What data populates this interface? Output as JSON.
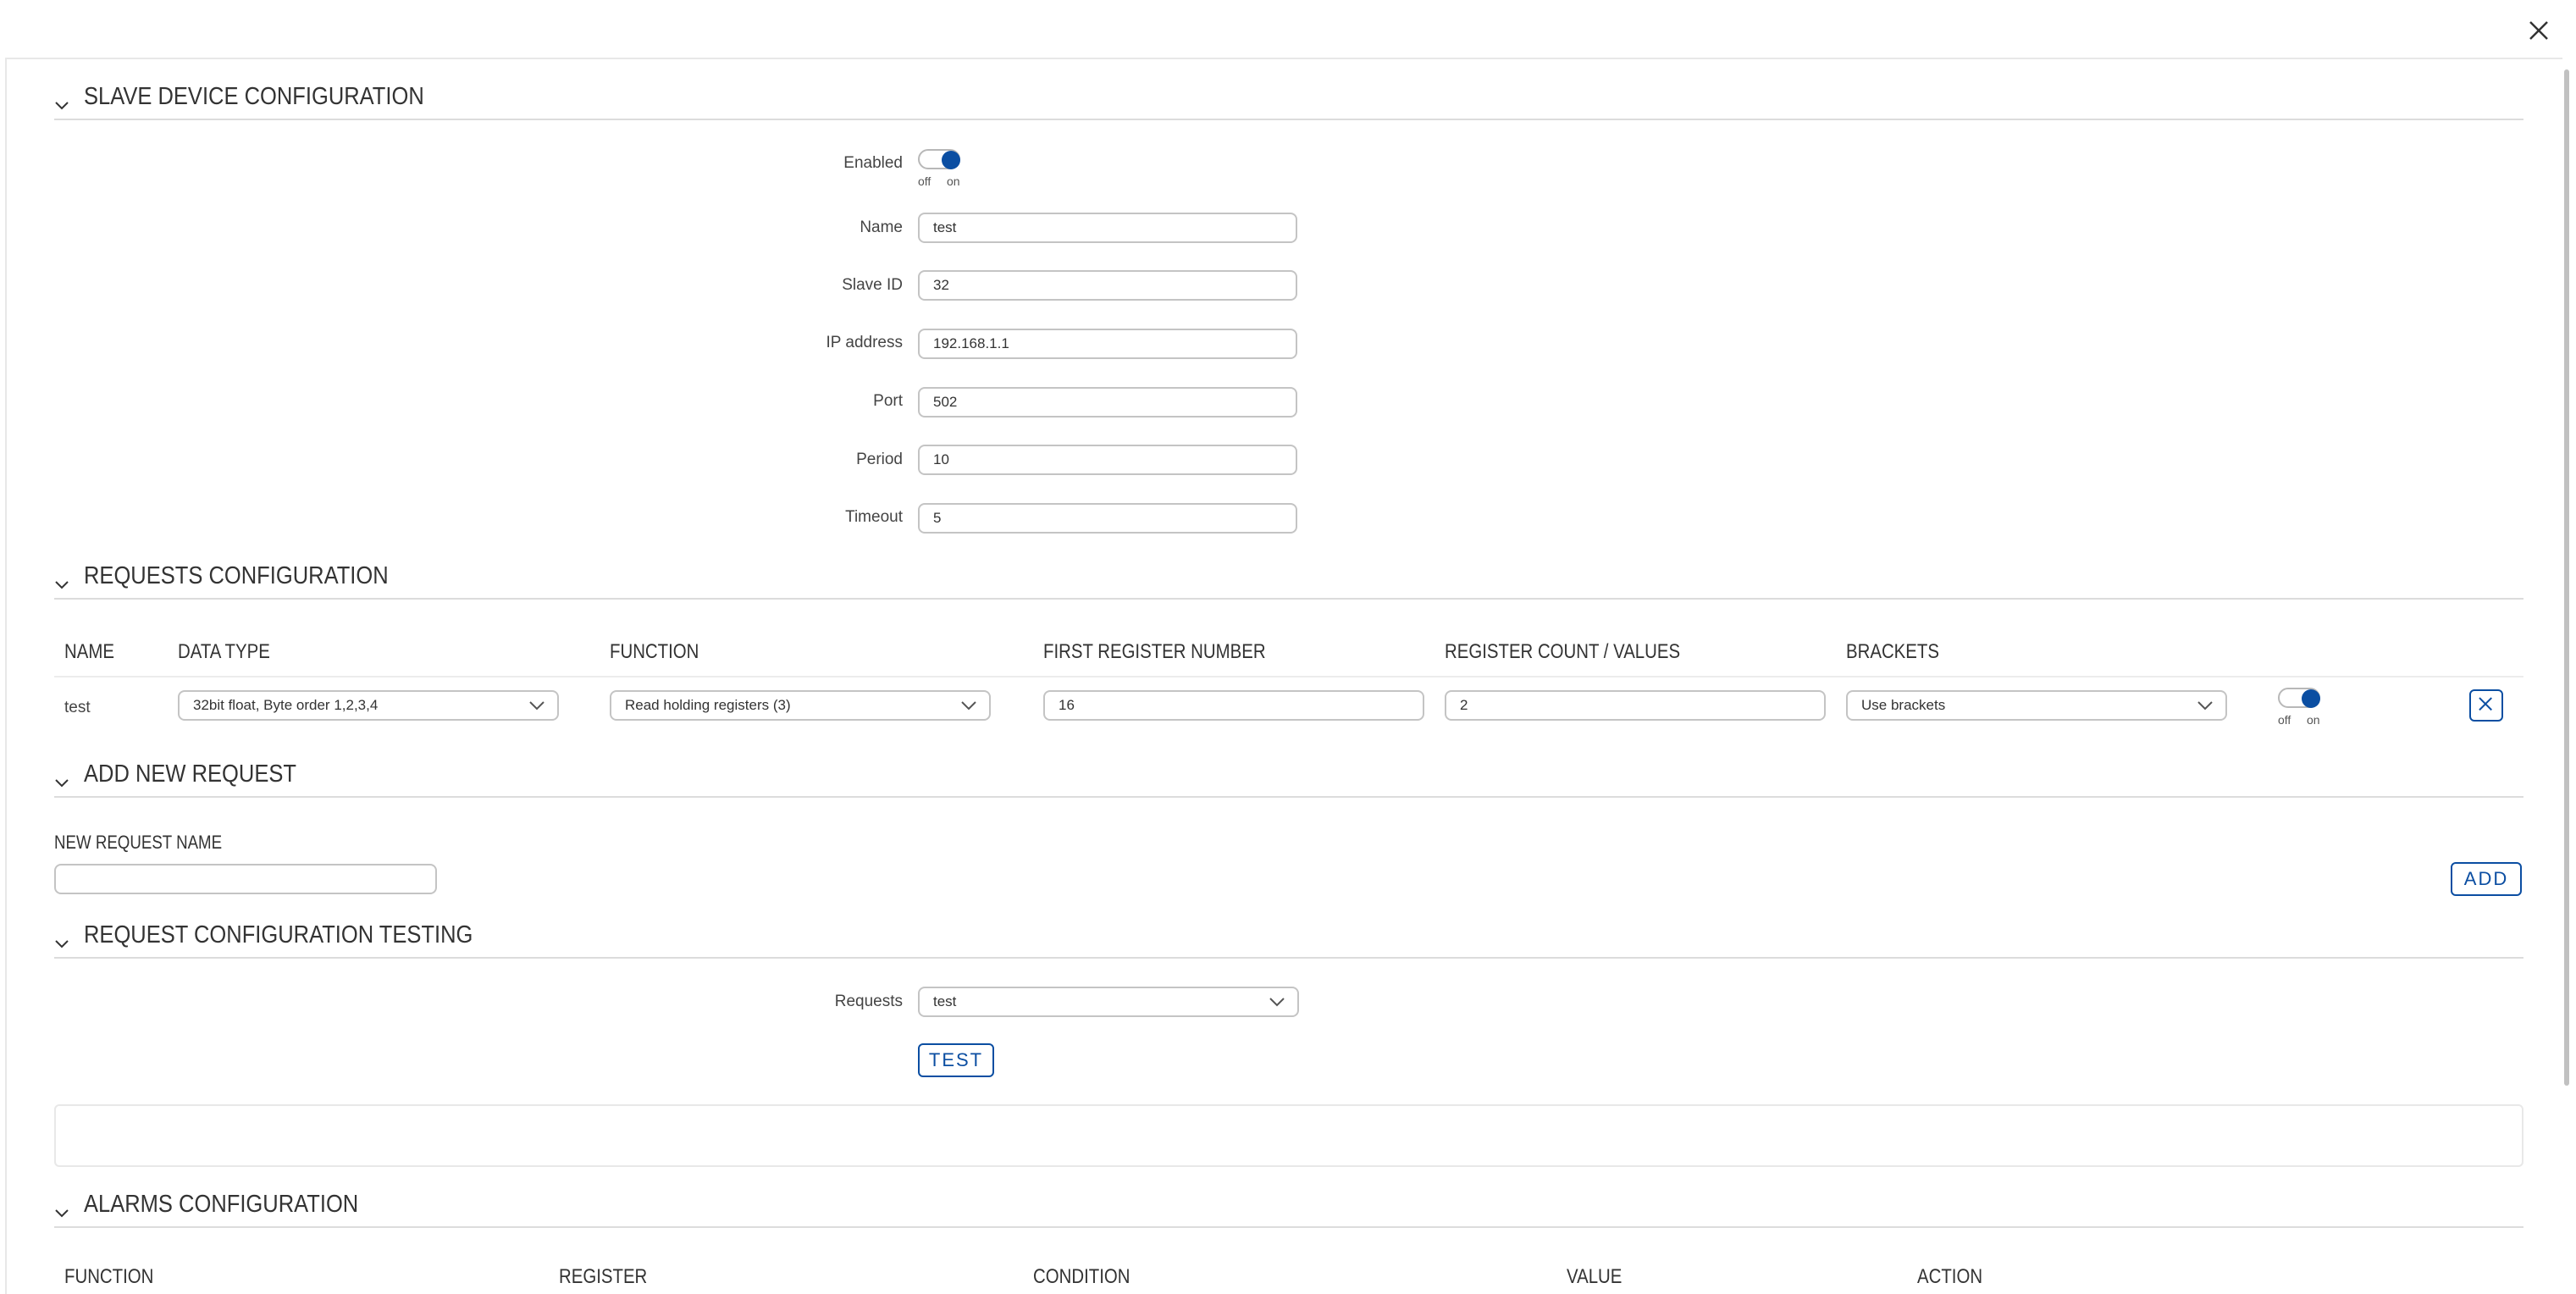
{
  "sections": {
    "slave": "SLAVE DEVICE CONFIGURATION",
    "requests": "REQUESTS CONFIGURATION",
    "add_new": "ADD NEW REQUEST",
    "testing": "REQUEST CONFIGURATION TESTING",
    "alarms": "ALARMS CONFIGURATION"
  },
  "slave": {
    "enabled_label": "Enabled",
    "toggle_off": "off",
    "toggle_on": "on",
    "enabled": true,
    "fields": {
      "name_label": "Name",
      "name_value": "test",
      "slave_id_label": "Slave ID",
      "slave_id_value": "32",
      "ip_label": "IP address",
      "ip_value": "192.168.1.1",
      "port_label": "Port",
      "port_value": "502",
      "period_label": "Period",
      "period_value": "10",
      "timeout_label": "Timeout",
      "timeout_value": "5"
    }
  },
  "requests": {
    "columns": {
      "name": "NAME",
      "data_type": "DATA TYPE",
      "function": "FUNCTION",
      "first_register": "FIRST REGISTER NUMBER",
      "register_count": "REGISTER COUNT / VALUES",
      "brackets": "BRACKETS"
    },
    "row": {
      "name": "test",
      "data_type": "32bit float, Byte order 1,2,3,4",
      "function": "Read holding registers (3)",
      "first_register": "16",
      "register_count": "2",
      "brackets": "Use brackets",
      "enabled": true,
      "toggle_off": "off",
      "toggle_on": "on"
    }
  },
  "add_new": {
    "label": "NEW REQUEST NAME",
    "value": "",
    "add_button": "ADD"
  },
  "testing": {
    "requests_label": "Requests",
    "requests_value": "test",
    "test_button": "TEST"
  },
  "alarms": {
    "columns": {
      "function": "FUNCTION",
      "register": "REGISTER",
      "condition": "CONDITION",
      "value": "VALUE",
      "action": "ACTION"
    }
  },
  "colors": {
    "accent": "#0b4ea2",
    "border": "#c4c4c4"
  }
}
